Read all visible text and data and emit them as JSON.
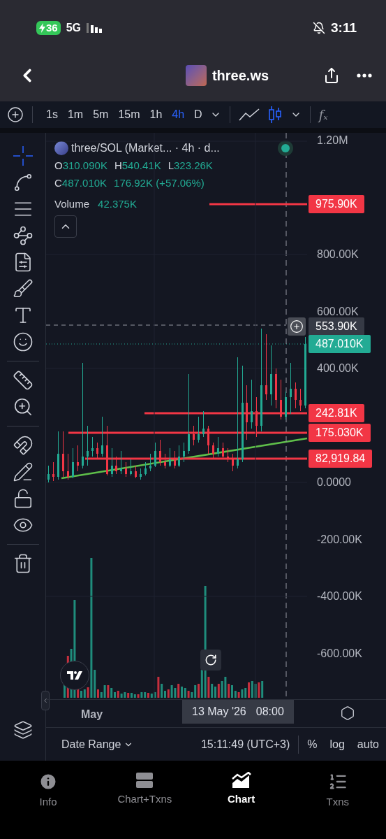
{
  "status_bar": {
    "battery": "36",
    "network": "5G",
    "time": "3:11"
  },
  "header": {
    "title": "three.ws"
  },
  "toolbar": {
    "timeframes": [
      {
        "label": "1s",
        "selected": false
      },
      {
        "label": "1m",
        "selected": false
      },
      {
        "label": "5m",
        "selected": false
      },
      {
        "label": "15m",
        "selected": false
      },
      {
        "label": "1h",
        "selected": false
      },
      {
        "label": "4h",
        "selected": true
      },
      {
        "label": "D",
        "selected": false
      }
    ],
    "chart_types": [
      {
        "kind": "line",
        "selected": false
      },
      {
        "kind": "candles",
        "selected": true
      }
    ],
    "indicators_symbol": "𝑓ₓ"
  },
  "chart": {
    "chart_data": {
      "type": "candlestick",
      "categories": [
        null,
        null,
        null,
        null,
        null,
        null,
        null,
        null,
        null,
        null,
        null,
        null,
        null,
        null,
        null,
        null,
        null,
        null,
        null,
        null,
        null,
        null,
        null,
        null,
        null,
        null,
        null,
        null,
        null,
        null,
        null,
        null,
        null,
        null,
        null,
        null,
        null,
        null,
        null,
        null,
        null,
        null,
        null,
        null,
        null,
        null,
        null,
        null,
        null,
        null,
        null,
        null,
        null,
        null
      ],
      "ylim": [
        -760700,
        1227000
      ],
      "grid": true,
      "yticks": [
        {
          "value": 1200000,
          "label": "1.20M"
        },
        {
          "value": 800000,
          "label": "800.00K"
        },
        {
          "value": 600000,
          "label": "600.00K"
        },
        {
          "value": 400000,
          "label": "400.00K"
        },
        {
          "value": 0,
          "label": "0.0000"
        },
        {
          "value": -200000,
          "label": "-200.00K"
        },
        {
          "value": -400000,
          "label": "-400.00K"
        },
        {
          "value": -600000,
          "label": "-600.00K"
        }
      ],
      "ohlc": [
        [
          10000,
          60000,
          0,
          30000
        ],
        [
          30000,
          70000,
          5000,
          20000
        ],
        [
          20000,
          180000,
          10000,
          100000
        ],
        [
          100000,
          180000,
          20000,
          40000
        ],
        [
          40000,
          100000,
          10000,
          20000
        ],
        [
          20000,
          120000,
          15000,
          70000
        ],
        [
          70000,
          130000,
          40000,
          60000
        ],
        [
          60000,
          420000,
          50000,
          90000
        ],
        [
          90000,
          200000,
          60000,
          110000
        ],
        [
          110000,
          160000,
          90000,
          120000
        ],
        [
          120000,
          140000,
          80000,
          100000
        ],
        [
          100000,
          230000,
          90000,
          130000
        ],
        [
          130000,
          200000,
          25000,
          30000
        ],
        [
          30000,
          120000,
          20000,
          60000
        ],
        [
          60000,
          90000,
          30000,
          40000
        ],
        [
          40000,
          110000,
          30000,
          50000
        ],
        [
          50000,
          70000,
          20000,
          30000
        ],
        [
          30000,
          80000,
          25000,
          40000
        ],
        [
          40000,
          60000,
          15000,
          20000
        ],
        [
          20000,
          50000,
          10000,
          30000
        ],
        [
          30000,
          70000,
          25000,
          50000
        ],
        [
          50000,
          100000,
          40000,
          60000
        ],
        [
          60000,
          140000,
          55000,
          110000
        ],
        [
          110000,
          150000,
          60000,
          70000
        ],
        [
          70000,
          100000,
          50000,
          60000
        ],
        [
          60000,
          120000,
          55000,
          80000
        ],
        [
          80000,
          110000,
          50000,
          60000
        ],
        [
          60000,
          130000,
          55000,
          90000
        ],
        [
          90000,
          140000,
          70000,
          110000
        ],
        [
          110000,
          380000,
          100000,
          170000
        ],
        [
          170000,
          200000,
          130000,
          150000
        ],
        [
          150000,
          230000,
          140000,
          170000
        ],
        [
          170000,
          250000,
          160000,
          190000
        ],
        [
          190000,
          200000,
          100000,
          130000
        ],
        [
          130000,
          140000,
          80000,
          100000
        ],
        [
          100000,
          160000,
          90000,
          120000
        ],
        [
          120000,
          140000,
          80000,
          90000
        ],
        [
          90000,
          120000,
          70000,
          80000
        ],
        [
          80000,
          100000,
          40000,
          60000
        ],
        [
          60000,
          440000,
          50000,
          80000
        ],
        [
          80000,
          410000,
          70000,
          280000
        ],
        [
          280000,
          340000,
          150000,
          210000
        ],
        [
          210000,
          360000,
          190000,
          250000
        ],
        [
          250000,
          300000,
          160000,
          200000
        ],
        [
          200000,
          540000,
          180000,
          340000
        ],
        [
          340000,
          520000,
          290000,
          310000
        ],
        [
          310000,
          480000,
          270000,
          380000
        ],
        [
          380000,
          400000,
          260000,
          290000
        ],
        [
          290000,
          360000,
          220000,
          230000
        ],
        [
          230000,
          320000,
          220000,
          300000
        ],
        [
          300000,
          420000,
          240000,
          330000
        ],
        [
          330000,
          350000,
          260000,
          290000
        ],
        [
          290000,
          330000,
          250000,
          270000
        ],
        [
          270000,
          510000,
          260000,
          487010
        ]
      ]
    }
  },
  "tools": [
    {
      "kind": "crosshair",
      "selected": true
    },
    {
      "kind": "trend-line",
      "selected": false
    },
    {
      "kind": "horizontal-lines",
      "selected": false
    },
    {
      "kind": "pattern",
      "selected": false
    },
    {
      "kind": "fib",
      "selected": false
    },
    {
      "kind": "brush",
      "selected": false
    },
    {
      "kind": "text",
      "selected": false
    },
    {
      "kind": "emoji",
      "selected": false
    },
    {
      "kind": "divider"
    },
    {
      "kind": "ruler",
      "selected": false
    },
    {
      "kind": "zoom",
      "selected": false
    },
    {
      "kind": "divider"
    },
    {
      "kind": "magnet",
      "selected": false
    },
    {
      "kind": "lock-drawing",
      "selected": false
    },
    {
      "kind": "lock",
      "selected": false
    },
    {
      "kind": "eye",
      "selected": false
    },
    {
      "kind": "divider"
    },
    {
      "kind": "trash",
      "selected": false
    }
  ],
  "legend": {
    "symbol": "three/SOL (Market... · 4h · d...",
    "ohlc": [
      {
        "key": "O",
        "value": "310.090K"
      },
      {
        "key": "H",
        "value": "540.41K"
      },
      {
        "key": "L",
        "value": "323.26K"
      },
      {
        "key": "C",
        "value": "487.010K"
      }
    ],
    "change": "176.92K (+57.06%)",
    "volume_label": "Volume",
    "volume_value": "42.375K"
  },
  "price_lines": [
    {
      "label": "975.90K",
      "kind": "alert"
    },
    {
      "label": "553.90K",
      "kind": "crosshair"
    },
    {
      "label": "487.010K",
      "kind": "last"
    },
    {
      "label": "242.81K",
      "kind": "alert"
    },
    {
      "label": "175.030K",
      "kind": "alert"
    },
    {
      "label": "82,919.84",
      "kind": "alert"
    }
  ],
  "time_axis": {
    "label": "May",
    "crosshair_date": "13 May '26",
    "crosshair_time": "08:00"
  },
  "bottom_bar": {
    "date_range": "Date Range",
    "clock": "15:11:49 (UTC+3)",
    "options": [
      "%",
      "log",
      "auto"
    ]
  },
  "tab_bar": [
    {
      "label": "Info",
      "kind": "info",
      "selected": false
    },
    {
      "label": "Chart+Txns",
      "kind": "split",
      "selected": false
    },
    {
      "label": "Chart",
      "kind": "chart",
      "selected": true
    },
    {
      "label": "Txns",
      "kind": "list",
      "selected": false
    }
  ]
}
